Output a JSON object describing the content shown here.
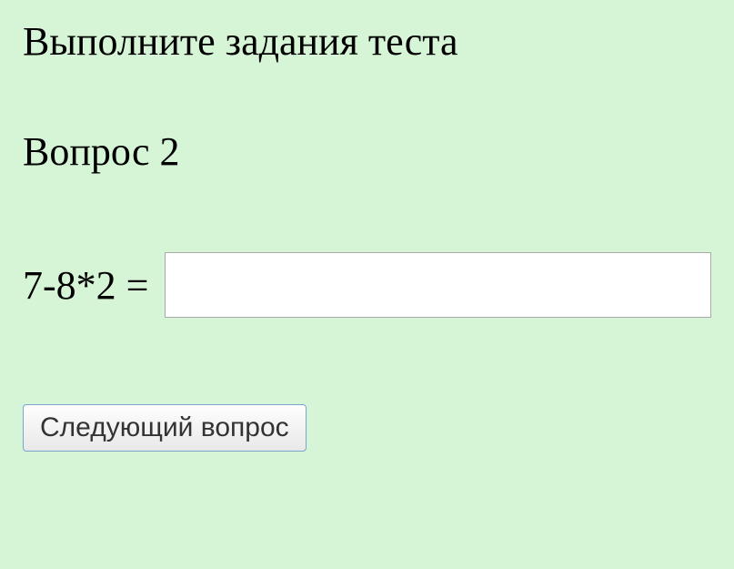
{
  "instruction": "Выполните задания теста",
  "question": {
    "label": "Вопрос 2",
    "expression": "7-8*2 =",
    "answer_value": ""
  },
  "buttons": {
    "next_label": "Следующий вопрос"
  }
}
